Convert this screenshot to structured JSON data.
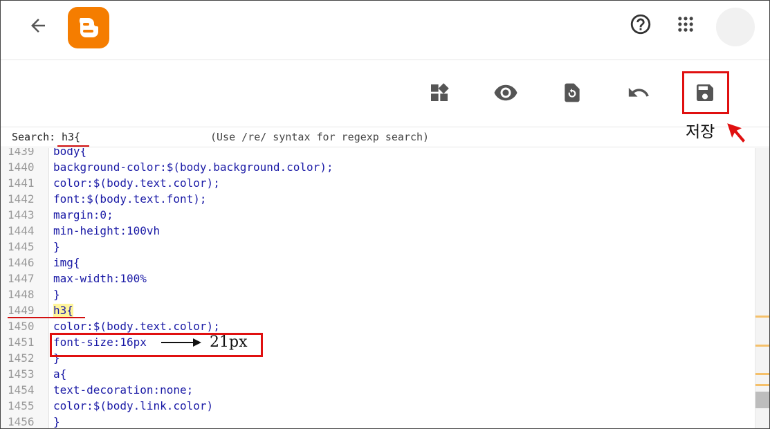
{
  "search": {
    "label": "Search:",
    "value": "h3{",
    "hint": "(Use /re/ syntax for regexp search)"
  },
  "annotations": {
    "save": "저장",
    "font_size_target": "21px"
  },
  "icons": {
    "back": "arrow-left-icon",
    "logo": "blogger-logo-icon",
    "help": "help-circle-icon",
    "apps": "apps-grid-icon",
    "widgets": "widgets-icon",
    "preview": "eye-icon",
    "restore": "restore-icon",
    "undo": "undo-icon",
    "save": "save-icon"
  },
  "colors": {
    "brand": "#f57d00",
    "annotation": "#e01010",
    "code": "#1a1aa6",
    "highlight": "#fff59a"
  },
  "editor": {
    "lines": [
      {
        "num": "1439",
        "code": "body{"
      },
      {
        "num": "1440",
        "code": "background-color:$(body.background.color);"
      },
      {
        "num": "1441",
        "code": "color:$(body.text.color);"
      },
      {
        "num": "1442",
        "code": "font:$(body.text.font);"
      },
      {
        "num": "1443",
        "code": "margin:0;"
      },
      {
        "num": "1444",
        "code": "min-height:100vh"
      },
      {
        "num": "1445",
        "code": "}"
      },
      {
        "num": "1446",
        "code": "img{"
      },
      {
        "num": "1447",
        "code": "max-width:100%"
      },
      {
        "num": "1448",
        "code": "}"
      },
      {
        "num": "1449",
        "code": "h3{"
      },
      {
        "num": "1450",
        "code": "color:$(body.text.color);"
      },
      {
        "num": "1451",
        "code": "font-size:16px"
      },
      {
        "num": "1452",
        "code": "}"
      },
      {
        "num": "1453",
        "code": "a{"
      },
      {
        "num": "1454",
        "code": "text-decoration:none;"
      },
      {
        "num": "1455",
        "code": "color:$(body.link.color)"
      },
      {
        "num": "1456",
        "code": "}"
      }
    ]
  }
}
